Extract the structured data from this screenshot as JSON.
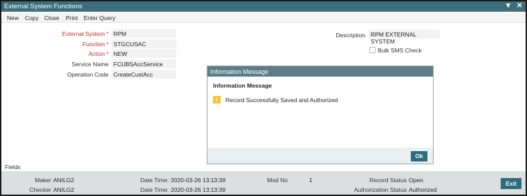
{
  "window": {
    "title": "External System Functions",
    "min_glyph": "▾",
    "close_glyph": "✕"
  },
  "menu": {
    "items": [
      "New",
      "Copy",
      "Close",
      "Print",
      "Enter Query"
    ]
  },
  "form": {
    "external_system_label": "External System",
    "external_system_value": "RPM",
    "function_label": "Function",
    "function_value": "STGCUSAC",
    "action_label": "Action",
    "action_value": "NEW",
    "service_name_label": "Service Name",
    "service_name_value": "FCUBSAccService",
    "operation_code_label": "Operation Code",
    "operation_code_value": "CreateCustAcc",
    "description_label": "Description",
    "description_value": "RPM  EXTERNAL SYSTEM",
    "bulk_sms_label": "Bulk SMS Check",
    "required_mark": "*"
  },
  "dialog": {
    "title": "Information Message",
    "heading": "Information Message",
    "icon_glyph": "i",
    "message": "Record Successfully Saved and Authorized",
    "ok_label": "Ok"
  },
  "fields_label": "Fields",
  "footer": {
    "maker_label": "Maker",
    "maker_value": "ANILG2",
    "checker_label": "Checker",
    "checker_value": "ANILG2",
    "date_time_label": "Date Time:",
    "maker_date_time": "2020-03-26 13:13:39",
    "checker_date_time": "2020-03-26 13:13:39",
    "mod_no_label": "Mod No",
    "mod_no_value": "1",
    "record_status_label": "Record Status",
    "record_status_value": "Open",
    "auth_status_label": "Authorization Status",
    "auth_status_value": "Authorized",
    "exit_label": "Exit"
  },
  "colors": {
    "titlebar": "#3e6e7b",
    "dialog_title": "#5c7f87",
    "button": "#2e6c7c",
    "required": "#c03020",
    "info_icon": "#f4c42a"
  }
}
